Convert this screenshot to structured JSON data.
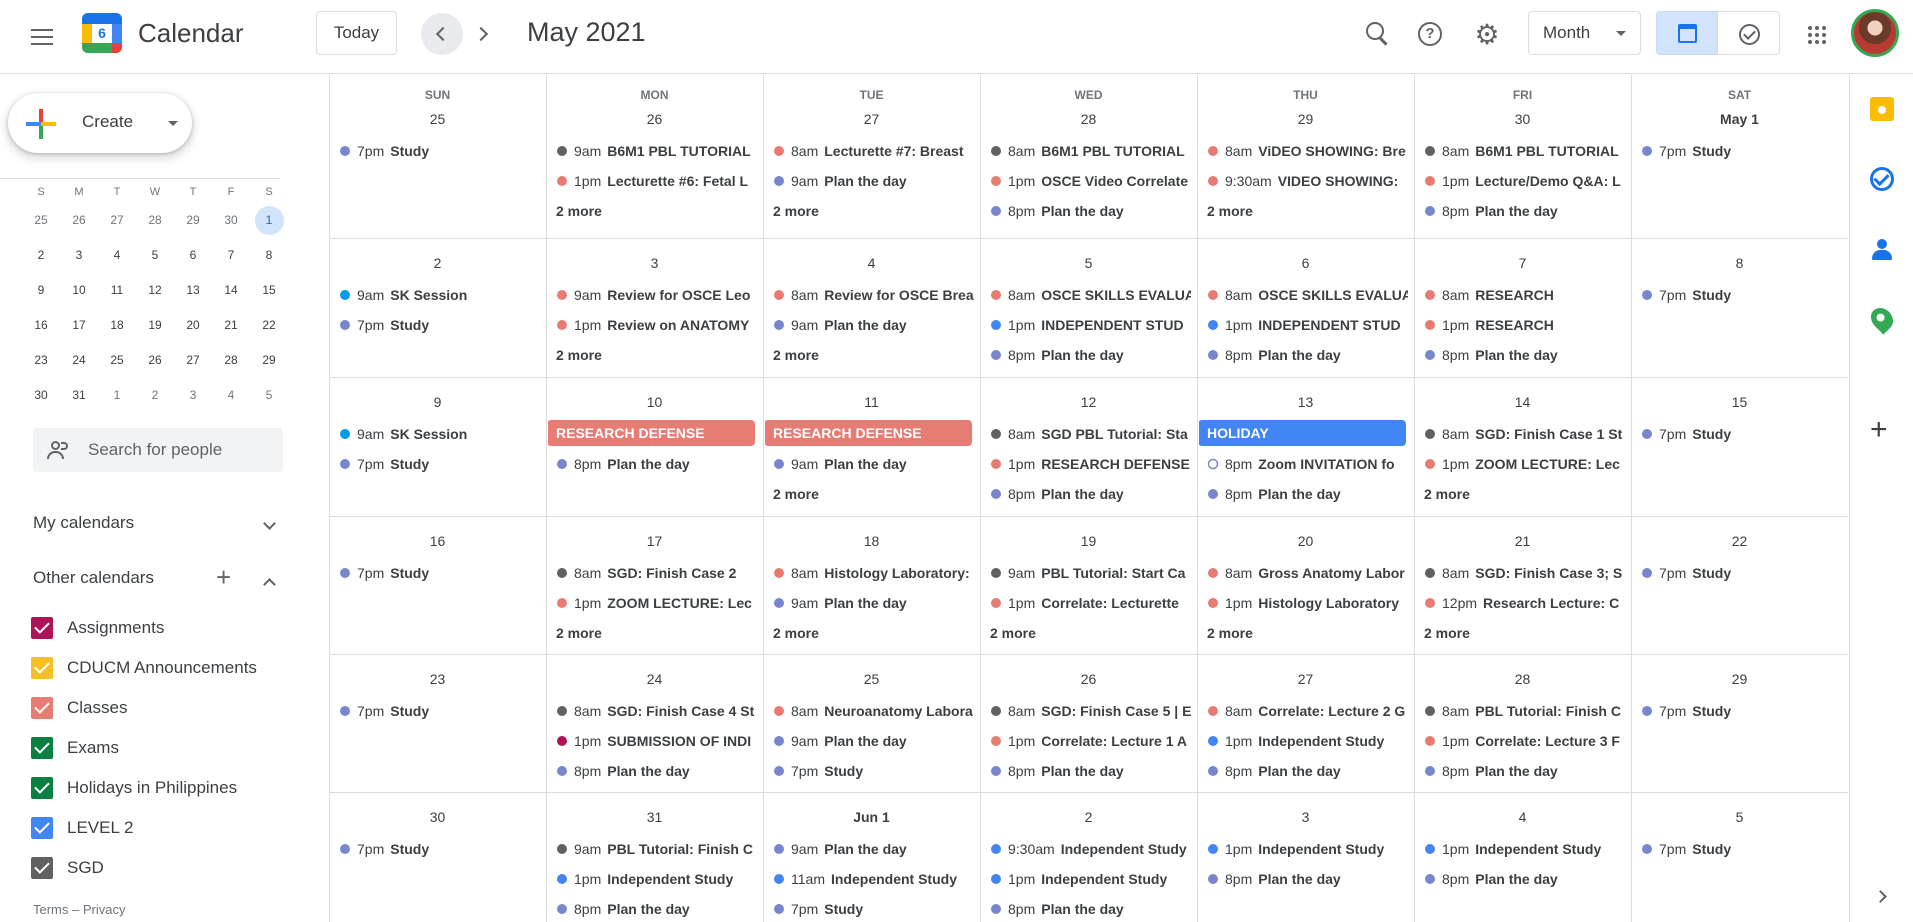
{
  "header": {
    "app_title": "Calendar",
    "logo_text": "6",
    "today_label": "Today",
    "month_label": "May 2021",
    "view_label": "Month"
  },
  "sidebar": {
    "create_label": "Create",
    "mini_weekdays": [
      "S",
      "M",
      "T",
      "W",
      "T",
      "F",
      "S"
    ],
    "mini_weeks": [
      [
        "25",
        "26",
        "27",
        "28",
        "29",
        "30",
        "1"
      ],
      [
        "2",
        "3",
        "4",
        "5",
        "6",
        "7",
        "8"
      ],
      [
        "9",
        "10",
        "11",
        "12",
        "13",
        "14",
        "15"
      ],
      [
        "16",
        "17",
        "18",
        "19",
        "20",
        "21",
        "22"
      ],
      [
        "23",
        "24",
        "25",
        "26",
        "27",
        "28",
        "29"
      ],
      [
        "30",
        "31",
        "1",
        "2",
        "3",
        "4",
        "5"
      ]
    ],
    "search_people_placeholder": "Search for people",
    "my_calendars_label": "My calendars",
    "other_calendars_label": "Other calendars",
    "calendars": [
      {
        "label": "Assignments",
        "color": "#ad1457"
      },
      {
        "label": "CDUCM Announcements",
        "color": "#f6bf26"
      },
      {
        "label": "Classes",
        "color": "#e67c73"
      },
      {
        "label": "Exams",
        "color": "#0b8043"
      },
      {
        "label": "Holidays in Philippines",
        "color": "#0b8043"
      },
      {
        "label": "LEVEL 2",
        "color": "#4285f4"
      },
      {
        "label": "SGD",
        "color": "#616161"
      }
    ],
    "footer": "Terms – Privacy"
  },
  "colors": {
    "sgd": "#616161",
    "classes": "#e67c73",
    "plan": "#7986cb",
    "level2": "#4285f4",
    "session": "#039be5",
    "assign": "#ad1457",
    "accent": "#1a73e8"
  },
  "calendar": {
    "weekdays": [
      "SUN",
      "MON",
      "TUE",
      "WED",
      "THU",
      "FRI",
      "SAT"
    ],
    "weeks": [
      [
        {
          "date": "25",
          "events": [
            {
              "time": "7pm",
              "title": "Study",
              "color": "#7986cb"
            }
          ]
        },
        {
          "date": "26",
          "events": [
            {
              "time": "9am",
              "title": "B6M1 PBL TUTORIAL",
              "color": "#616161"
            },
            {
              "time": "1pm",
              "title": "Lecturette #6: Fetal L",
              "color": "#e67c73"
            }
          ],
          "more": "2 more"
        },
        {
          "date": "27",
          "events": [
            {
              "time": "8am",
              "title": "Lecturette #7: Breast",
              "color": "#e67c73"
            },
            {
              "time": "9am",
              "title": "Plan the day",
              "color": "#7986cb"
            }
          ],
          "more": "2 more"
        },
        {
          "date": "28",
          "events": [
            {
              "time": "8am",
              "title": "B6M1 PBL TUTORIAL",
              "color": "#616161"
            },
            {
              "time": "1pm",
              "title": "OSCE Video Correlate",
              "color": "#e67c73"
            },
            {
              "time": "8pm",
              "title": "Plan the day",
              "color": "#7986cb"
            }
          ]
        },
        {
          "date": "29",
          "events": [
            {
              "time": "8am",
              "title": "ViDEO SHOWING: Bre",
              "color": "#e67c73"
            },
            {
              "time": "9:30am",
              "title": "VIDEO SHOWING:",
              "color": "#e67c73"
            }
          ],
          "more": "2 more"
        },
        {
          "date": "30",
          "events": [
            {
              "time": "8am",
              "title": "B6M1 PBL TUTORIAL",
              "color": "#616161"
            },
            {
              "time": "1pm",
              "title": "Lecture/Demo Q&A: L",
              "color": "#e67c73"
            },
            {
              "time": "8pm",
              "title": "Plan the day",
              "color": "#7986cb"
            }
          ]
        },
        {
          "date": "May 1",
          "events": [
            {
              "time": "7pm",
              "title": "Study",
              "color": "#7986cb"
            }
          ]
        }
      ],
      [
        {
          "date": "2",
          "events": [
            {
              "time": "9am",
              "title": "SK Session",
              "color": "#039be5"
            },
            {
              "time": "7pm",
              "title": "Study",
              "color": "#7986cb"
            }
          ]
        },
        {
          "date": "3",
          "events": [
            {
              "time": "9am",
              "title": "Review for OSCE Leo",
              "color": "#e67c73"
            },
            {
              "time": "1pm",
              "title": "Review on ANATOMY",
              "color": "#e67c73"
            }
          ],
          "more": "2 more"
        },
        {
          "date": "4",
          "events": [
            {
              "time": "8am",
              "title": "Review for OSCE Brea",
              "color": "#e67c73"
            },
            {
              "time": "9am",
              "title": "Plan the day",
              "color": "#7986cb"
            }
          ],
          "more": "2 more"
        },
        {
          "date": "5",
          "events": [
            {
              "time": "8am",
              "title": "OSCE SKILLS EVALUA",
              "color": "#e67c73"
            },
            {
              "time": "1pm",
              "title": "INDEPENDENT STUD",
              "color": "#4285f4"
            },
            {
              "time": "8pm",
              "title": "Plan the day",
              "color": "#7986cb"
            }
          ]
        },
        {
          "date": "6",
          "events": [
            {
              "time": "8am",
              "title": "OSCE SKILLS EVALUA",
              "color": "#e67c73"
            },
            {
              "time": "1pm",
              "title": "INDEPENDENT STUD",
              "color": "#4285f4"
            },
            {
              "time": "8pm",
              "title": "Plan the day",
              "color": "#7986cb"
            }
          ]
        },
        {
          "date": "7",
          "events": [
            {
              "time": "8am",
              "title": "RESEARCH",
              "color": "#e67c73"
            },
            {
              "time": "1pm",
              "title": "RESEARCH",
              "color": "#e67c73"
            },
            {
              "time": "8pm",
              "title": "Plan the day",
              "color": "#7986cb"
            }
          ]
        },
        {
          "date": "8",
          "events": [
            {
              "time": "7pm",
              "title": "Study",
              "color": "#7986cb"
            }
          ]
        }
      ],
      [
        {
          "date": "9",
          "events": [
            {
              "time": "9am",
              "title": "SK Session",
              "color": "#039be5"
            },
            {
              "time": "7pm",
              "title": "Study",
              "color": "#7986cb"
            }
          ]
        },
        {
          "date": "10",
          "allday": {
            "title": "RESEARCH DEFENSE",
            "color": "#e67c73"
          },
          "events": [
            {
              "time": "8pm",
              "title": "Plan the day",
              "color": "#7986cb"
            }
          ]
        },
        {
          "date": "11",
          "allday": {
            "title": "RESEARCH DEFENSE",
            "color": "#e67c73"
          },
          "events": [
            {
              "time": "9am",
              "title": "Plan the day",
              "color": "#7986cb"
            }
          ],
          "more": "2 more"
        },
        {
          "date": "12",
          "events": [
            {
              "time": "8am",
              "title": "SGD PBL Tutorial: Sta",
              "color": "#616161"
            },
            {
              "time": "1pm",
              "title": "RESEARCH DEFENSE",
              "color": "#e67c73"
            },
            {
              "time": "8pm",
              "title": "Plan the day",
              "color": "#7986cb"
            }
          ]
        },
        {
          "date": "13",
          "allday": {
            "title": "HOLIDAY",
            "color": "#4285f4"
          },
          "events": [
            {
              "time": "8pm",
              "title": "Zoom INVITATION fo",
              "color": "#7986cb",
              "hollow": true
            },
            {
              "time": "8pm",
              "title": "Plan the day",
              "color": "#7986cb"
            }
          ]
        },
        {
          "date": "14",
          "events": [
            {
              "time": "8am",
              "title": "SGD: Finish Case 1 St",
              "color": "#616161"
            },
            {
              "time": "1pm",
              "title": "ZOOM LECTURE: Lec",
              "color": "#e67c73"
            }
          ],
          "more": "2 more"
        },
        {
          "date": "15",
          "events": [
            {
              "time": "7pm",
              "title": "Study",
              "color": "#7986cb"
            }
          ]
        }
      ],
      [
        {
          "date": "16",
          "events": [
            {
              "time": "7pm",
              "title": "Study",
              "color": "#7986cb"
            }
          ]
        },
        {
          "date": "17",
          "events": [
            {
              "time": "8am",
              "title": "SGD: Finish Case 2",
              "color": "#616161"
            },
            {
              "time": "1pm",
              "title": "ZOOM LECTURE: Lec",
              "color": "#e67c73"
            }
          ],
          "more": "2 more"
        },
        {
          "date": "18",
          "events": [
            {
              "time": "8am",
              "title": "Histology Laboratory:",
              "color": "#e67c73"
            },
            {
              "time": "9am",
              "title": "Plan the day",
              "color": "#7986cb"
            }
          ],
          "more": "2 more"
        },
        {
          "date": "19",
          "events": [
            {
              "time": "9am",
              "title": "PBL Tutorial: Start Ca",
              "color": "#616161"
            },
            {
              "time": "1pm",
              "title": "Correlate: Lecturette",
              "color": "#e67c73"
            }
          ],
          "more": "2 more"
        },
        {
          "date": "20",
          "events": [
            {
              "time": "8am",
              "title": "Gross Anatomy Labor",
              "color": "#e67c73"
            },
            {
              "time": "1pm",
              "title": "Histology Laboratory",
              "color": "#e67c73"
            }
          ],
          "more": "2 more"
        },
        {
          "date": "21",
          "events": [
            {
              "time": "8am",
              "title": "SGD: Finish Case 3; S",
              "color": "#616161"
            },
            {
              "time": "12pm",
              "title": "Research Lecture: C",
              "color": "#e67c73"
            }
          ],
          "more": "2 more"
        },
        {
          "date": "22",
          "events": [
            {
              "time": "7pm",
              "title": "Study",
              "color": "#7986cb"
            }
          ]
        }
      ],
      [
        {
          "date": "23",
          "events": [
            {
              "time": "7pm",
              "title": "Study",
              "color": "#7986cb"
            }
          ]
        },
        {
          "date": "24",
          "events": [
            {
              "time": "8am",
              "title": "SGD: Finish Case 4 St",
              "color": "#616161"
            },
            {
              "time": "1pm",
              "title": "SUBMISSION OF INDI",
              "color": "#ad1457"
            },
            {
              "time": "8pm",
              "title": "Plan the day",
              "color": "#7986cb"
            }
          ]
        },
        {
          "date": "25",
          "events": [
            {
              "time": "8am",
              "title": "Neuroanatomy Labora",
              "color": "#e67c73"
            },
            {
              "time": "9am",
              "title": "Plan the day",
              "color": "#7986cb"
            },
            {
              "time": "7pm",
              "title": "Study",
              "color": "#7986cb"
            }
          ]
        },
        {
          "date": "26",
          "events": [
            {
              "time": "8am",
              "title": "SGD: Finish Case 5 | E",
              "color": "#616161"
            },
            {
              "time": "1pm",
              "title": "Correlate: Lecture 1 A",
              "color": "#e67c73"
            },
            {
              "time": "8pm",
              "title": "Plan the day",
              "color": "#7986cb"
            }
          ]
        },
        {
          "date": "27",
          "events": [
            {
              "time": "8am",
              "title": "Correlate: Lecture 2 G",
              "color": "#e67c73"
            },
            {
              "time": "1pm",
              "title": "Independent Study",
              "color": "#4285f4"
            },
            {
              "time": "8pm",
              "title": "Plan the day",
              "color": "#7986cb"
            }
          ]
        },
        {
          "date": "28",
          "events": [
            {
              "time": "8am",
              "title": "PBL Tutorial: Finish C",
              "color": "#616161"
            },
            {
              "time": "1pm",
              "title": "Correlate: Lecture 3 F",
              "color": "#e67c73"
            },
            {
              "time": "8pm",
              "title": "Plan the day",
              "color": "#7986cb"
            }
          ]
        },
        {
          "date": "29",
          "events": [
            {
              "time": "7pm",
              "title": "Study",
              "color": "#7986cb"
            }
          ]
        }
      ],
      [
        {
          "date": "30",
          "events": [
            {
              "time": "7pm",
              "title": "Study",
              "color": "#7986cb"
            }
          ]
        },
        {
          "date": "31",
          "events": [
            {
              "time": "9am",
              "title": "PBL Tutorial: Finish C",
              "color": "#616161"
            },
            {
              "time": "1pm",
              "title": "Independent Study",
              "color": "#4285f4"
            },
            {
              "time": "8pm",
              "title": "Plan the day",
              "color": "#7986cb"
            }
          ]
        },
        {
          "date": "Jun 1",
          "events": [
            {
              "time": "9am",
              "title": "Plan the day",
              "color": "#7986cb"
            },
            {
              "time": "11am",
              "title": "Independent Study",
              "color": "#4285f4"
            },
            {
              "time": "7pm",
              "title": "Study",
              "color": "#7986cb"
            }
          ]
        },
        {
          "date": "2",
          "events": [
            {
              "time": "9:30am",
              "title": "Independent Study",
              "color": "#4285f4"
            },
            {
              "time": "1pm",
              "title": "Independent Study",
              "color": "#4285f4"
            },
            {
              "time": "8pm",
              "title": "Plan the day",
              "color": "#7986cb"
            }
          ]
        },
        {
          "date": "3",
          "events": [
            {
              "time": "1pm",
              "title": "Independent Study",
              "color": "#4285f4"
            },
            {
              "time": "8pm",
              "title": "Plan the day",
              "color": "#7986cb"
            }
          ]
        },
        {
          "date": "4",
          "events": [
            {
              "time": "1pm",
              "title": "Independent Study",
              "color": "#4285f4"
            },
            {
              "time": "8pm",
              "title": "Plan the day",
              "color": "#7986cb"
            }
          ]
        },
        {
          "date": "5",
          "events": [
            {
              "time": "7pm",
              "title": "Study",
              "color": "#7986cb"
            }
          ]
        }
      ]
    ]
  }
}
